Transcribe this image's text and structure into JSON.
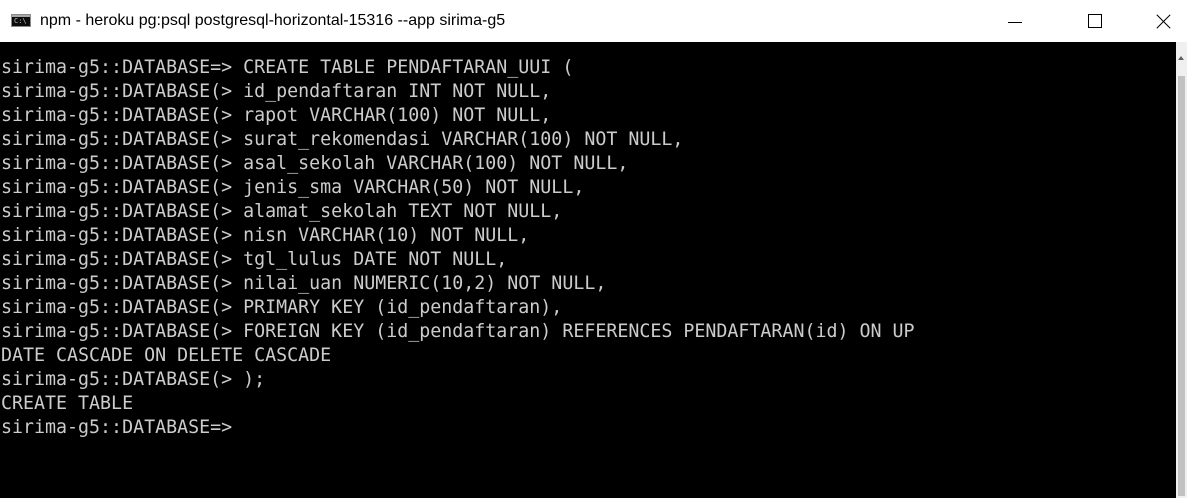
{
  "window": {
    "title": "npm - heroku  pg:psql postgresql-horizontal-15316 --app sirima-g5",
    "icon_text": "C:\\",
    "icon": "console-window-icon",
    "controls": {
      "minimize_icon": "minimize-icon",
      "maximize_icon": "maximize-icon",
      "close_icon": "close-icon"
    }
  },
  "console": {
    "lines": [
      "sirima-g5::DATABASE=> CREATE TABLE PENDAFTARAN_UUI (",
      "sirima-g5::DATABASE(> id_pendaftaran INT NOT NULL,",
      "sirima-g5::DATABASE(> rapot VARCHAR(100) NOT NULL,",
      "sirima-g5::DATABASE(> surat_rekomendasi VARCHAR(100) NOT NULL,",
      "sirima-g5::DATABASE(> asal_sekolah VARCHAR(100) NOT NULL,",
      "sirima-g5::DATABASE(> jenis_sma VARCHAR(50) NOT NULL,",
      "sirima-g5::DATABASE(> alamat_sekolah TEXT NOT NULL,",
      "sirima-g5::DATABASE(> nisn VARCHAR(10) NOT NULL,",
      "sirima-g5::DATABASE(> tgl_lulus DATE NOT NULL,",
      "sirima-g5::DATABASE(> nilai_uan NUMERIC(10,2) NOT NULL,",
      "sirima-g5::DATABASE(> PRIMARY KEY (id_pendaftaran),",
      "sirima-g5::DATABASE(> FOREIGN KEY (id_pendaftaran) REFERENCES PENDAFTARAN(id) ON UP",
      "DATE CASCADE ON DELETE CASCADE",
      "sirima-g5::DATABASE(> );",
      "CREATE TABLE",
      "sirima-g5::DATABASE=>"
    ]
  },
  "colors": {
    "console_background": "#000000",
    "console_text": "#cccccc",
    "titlebar_background": "#ffffff"
  }
}
